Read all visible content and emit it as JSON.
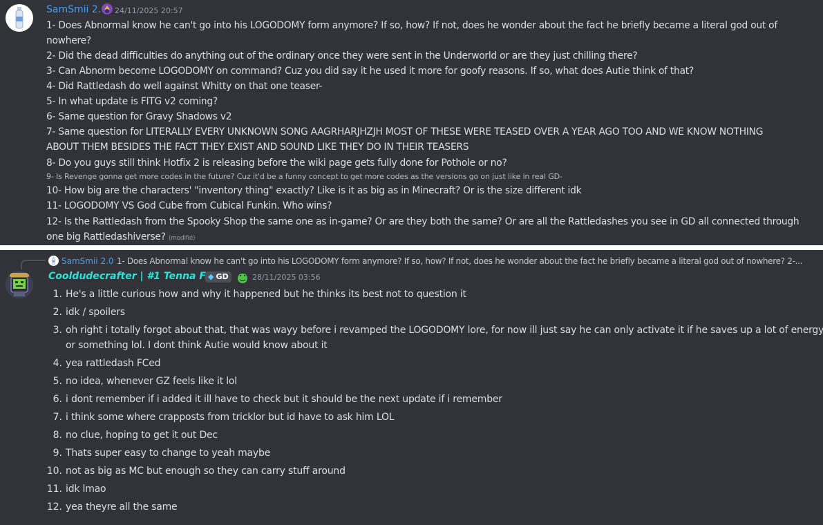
{
  "message1": {
    "username": "SamSmii 2.0",
    "timestamp": "24/11/2025 20:57",
    "lines": [
      "1- Does Abnormal know he can't go into his LOGODOMY form anymore? If so, how? If not, does he wonder about the fact he briefly became a literal god out of",
      "nowhere?",
      "2- Did the dead difficulties do anything out of the ordinary once they were sent in the Underworld or are they just chilling there?",
      "3- Can Abnorm become LOGODOMY on command? Cuz you did say it he used it more for goofy reasons. If so, what does Autie think of that?",
      "4- Did Rattledash do well against Whitty on that one teaser-",
      "5- In what update is FITG v2 coming?",
      "6- Same question for Gravy Shadows v2",
      "7- Same question for LITERALLY EVERY UNKNOWN SONG AAGRHARJHZJH MOST OF THESE WERE TEASED OVER A YEAR AGO TOO AND WE KNOW NOTHING",
      "ABOUT THEM BESIDES THE FACT THEY EXIST AND SOUND LIKE THEY DO IN THEIR TEASERS",
      "8- Do you guys still think Hotfix 2 is releasing before the wiki page gets fully done for Pothole or no?",
      "9- Is Revenge gonna get more codes in the future? Cuz it'd be a funny concept to get more codes as the versions go on just like in real GD-",
      "10- How big are the characters' \"inventory thing\" exactly? Like is it as big as in Minecraft? Or is the size different idk",
      "11- LOGODOMY VS God Cube from Cubical Funkin. Who wins?",
      "12- Is the Rattledash from the Spooky Shop the same one as in-game? Or are they both the same? Or are all the Rattledashes you see in GD all connected through",
      "one big Rattledashiverse?"
    ],
    "edited_label": "(modifié)"
  },
  "reply_preview": {
    "username": "SamSmii 2.0",
    "text": "1- Does Abnormal know he can't go into his LOGODOMY form anymore? If so, how? If not, does he wonder about the fact he briefly became a literal god out of nowhere? 2-..."
  },
  "message2": {
    "username": "Cooldudecrafter | #1 Tenna Fan",
    "tag": "GD",
    "timestamp": "28/11/2025 03:56",
    "items": [
      {
        "num": "1.",
        "text": "He's a little curious how and why it happened but he thinks its best not to question it"
      },
      {
        "num": "2.",
        "text": "idk / spoilers"
      },
      {
        "num": "3.",
        "text": "oh right i totally forgot about that, that was wayy before i revamped the LOGODOMY lore, for now ill just say he can only activate it if he saves up a lot of energy",
        "text2": "or something lol. I dont think Autie would know about it"
      },
      {
        "num": "4.",
        "text": "yea rattledash FCed"
      },
      {
        "num": "5.",
        "text": "no idea, whenever GZ feels like it lol"
      },
      {
        "num": "6.",
        "text": "i dont remember if i added it ill have to check but it should be the next update if i remember"
      },
      {
        "num": "7.",
        "text": "i think some where crapposts from tricklor but id have to ask him LOL"
      },
      {
        "num": "8.",
        "text": "no clue, hoping to get it out Dec"
      },
      {
        "num": "9.",
        "text": "Thats super easy to change to yeah maybe"
      },
      {
        "num": "10.",
        "text": "not as big as MC but enough so they can carry stuff around"
      },
      {
        "num": "11.",
        "text": "idk lmao"
      },
      {
        "num": "12.",
        "text": "yea theyre all the same"
      }
    ]
  },
  "icons": {
    "avatar1": "water-bottle-icon",
    "avatar2": "robot-avatar-icon",
    "role1": "purple-role-icon",
    "role2": "green-frog-role-icon",
    "tag_gem": "gem-icon"
  }
}
